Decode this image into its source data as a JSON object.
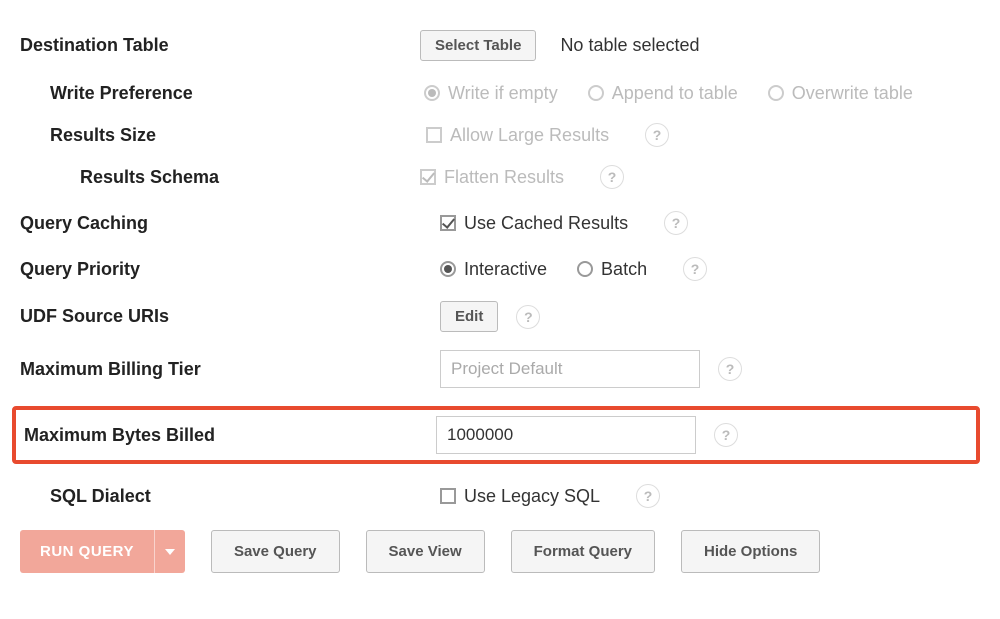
{
  "destinationTable": {
    "label": "Destination Table",
    "selectButton": "Select Table",
    "status": "No table selected"
  },
  "writePreference": {
    "label": "Write Preference",
    "options": {
      "writeIfEmpty": "Write if empty",
      "appendToTable": "Append to table",
      "overwriteTable": "Overwrite table"
    }
  },
  "resultsSize": {
    "label": "Results Size",
    "allowLarge": "Allow Large Results"
  },
  "resultsSchema": {
    "label": "Results Schema",
    "flatten": "Flatten Results"
  },
  "queryCaching": {
    "label": "Query Caching",
    "useCached": "Use Cached Results"
  },
  "queryPriority": {
    "label": "Query Priority",
    "interactive": "Interactive",
    "batch": "Batch"
  },
  "udfSource": {
    "label": "UDF Source URIs",
    "edit": "Edit"
  },
  "maxBillingTier": {
    "label": "Maximum Billing Tier",
    "placeholder": "Project Default",
    "value": ""
  },
  "maxBytesBilled": {
    "label": "Maximum Bytes Billed",
    "value": "1000000"
  },
  "sqlDialect": {
    "label": "SQL Dialect",
    "useLegacy": "Use Legacy SQL"
  },
  "buttons": {
    "runQuery": "RUN QUERY",
    "saveQuery": "Save Query",
    "saveView": "Save View",
    "formatQuery": "Format Query",
    "hideOptions": "Hide Options"
  },
  "help": "?"
}
